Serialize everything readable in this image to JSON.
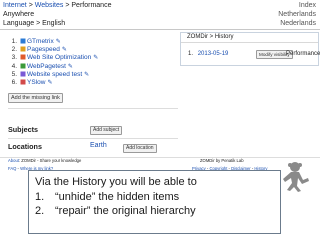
{
  "header": {
    "breadcrumb": {
      "root": "Internet",
      "sep1": " > ",
      "mid": "Websites",
      "sep2": " > ",
      "current": "Performance"
    },
    "breadcrumb_right": "Index",
    "row2_left": "Anywhere",
    "row2_right": "Netherlands",
    "row3_label": "Language > ",
    "row3_value": "English",
    "row3_right": "Nederlands"
  },
  "sites": [
    {
      "num": "1.",
      "name": "GTmetrix",
      "color": "#2b7bd6"
    },
    {
      "num": "2.",
      "name": "Pagespeed",
      "color": "#e0a020"
    },
    {
      "num": "3.",
      "name": "Web Site Optimization",
      "color": "#e05a2a"
    },
    {
      "num": "4.",
      "name": "WebPagetest",
      "color": "#3a9a3a"
    },
    {
      "num": "5.",
      "name": "Website speed test",
      "color": "#7a5ad6"
    },
    {
      "num": "6.",
      "name": "YSlow",
      "color": "#d24a4a"
    }
  ],
  "add_missing_label": "Add the missing link",
  "subjects": {
    "label": "Subjects",
    "button": "Add subject"
  },
  "locations": {
    "label": "Locations",
    "value": "Earth",
    "button": "Add location"
  },
  "footer": {
    "about_label": "About",
    "about_text": ": ZOMDir - Share your knowledge",
    "faq": "FAQ",
    "faq_sep": " - ",
    "where_help": "Where is my link?",
    "right_top": "ZOMDir by Penatik Lab",
    "privacy": "Privacy",
    "copyright": "Copyright",
    "disclaimer": "Disclaimer",
    "history": "History",
    "sep": " - "
  },
  "popup": {
    "title": "ZOMDir > History",
    "entry_num": "1.",
    "entry_date": "2013-05-19",
    "modify_button": "Modify visibility",
    "entry_label": "Performance"
  },
  "caption": {
    "line1": "Via the History you will be able to",
    "item1_num": "1.",
    "item1_text": "“unhide” the hidden items",
    "item2_num": "2.",
    "item2_text": "“repair” the original hierarchy"
  },
  "colors": {
    "link": "#1a4fb0",
    "accent_green": "#2f8a2f"
  },
  "icons": [
    "pencil-icon",
    "favicon",
    "monkey-logo-icon"
  ]
}
